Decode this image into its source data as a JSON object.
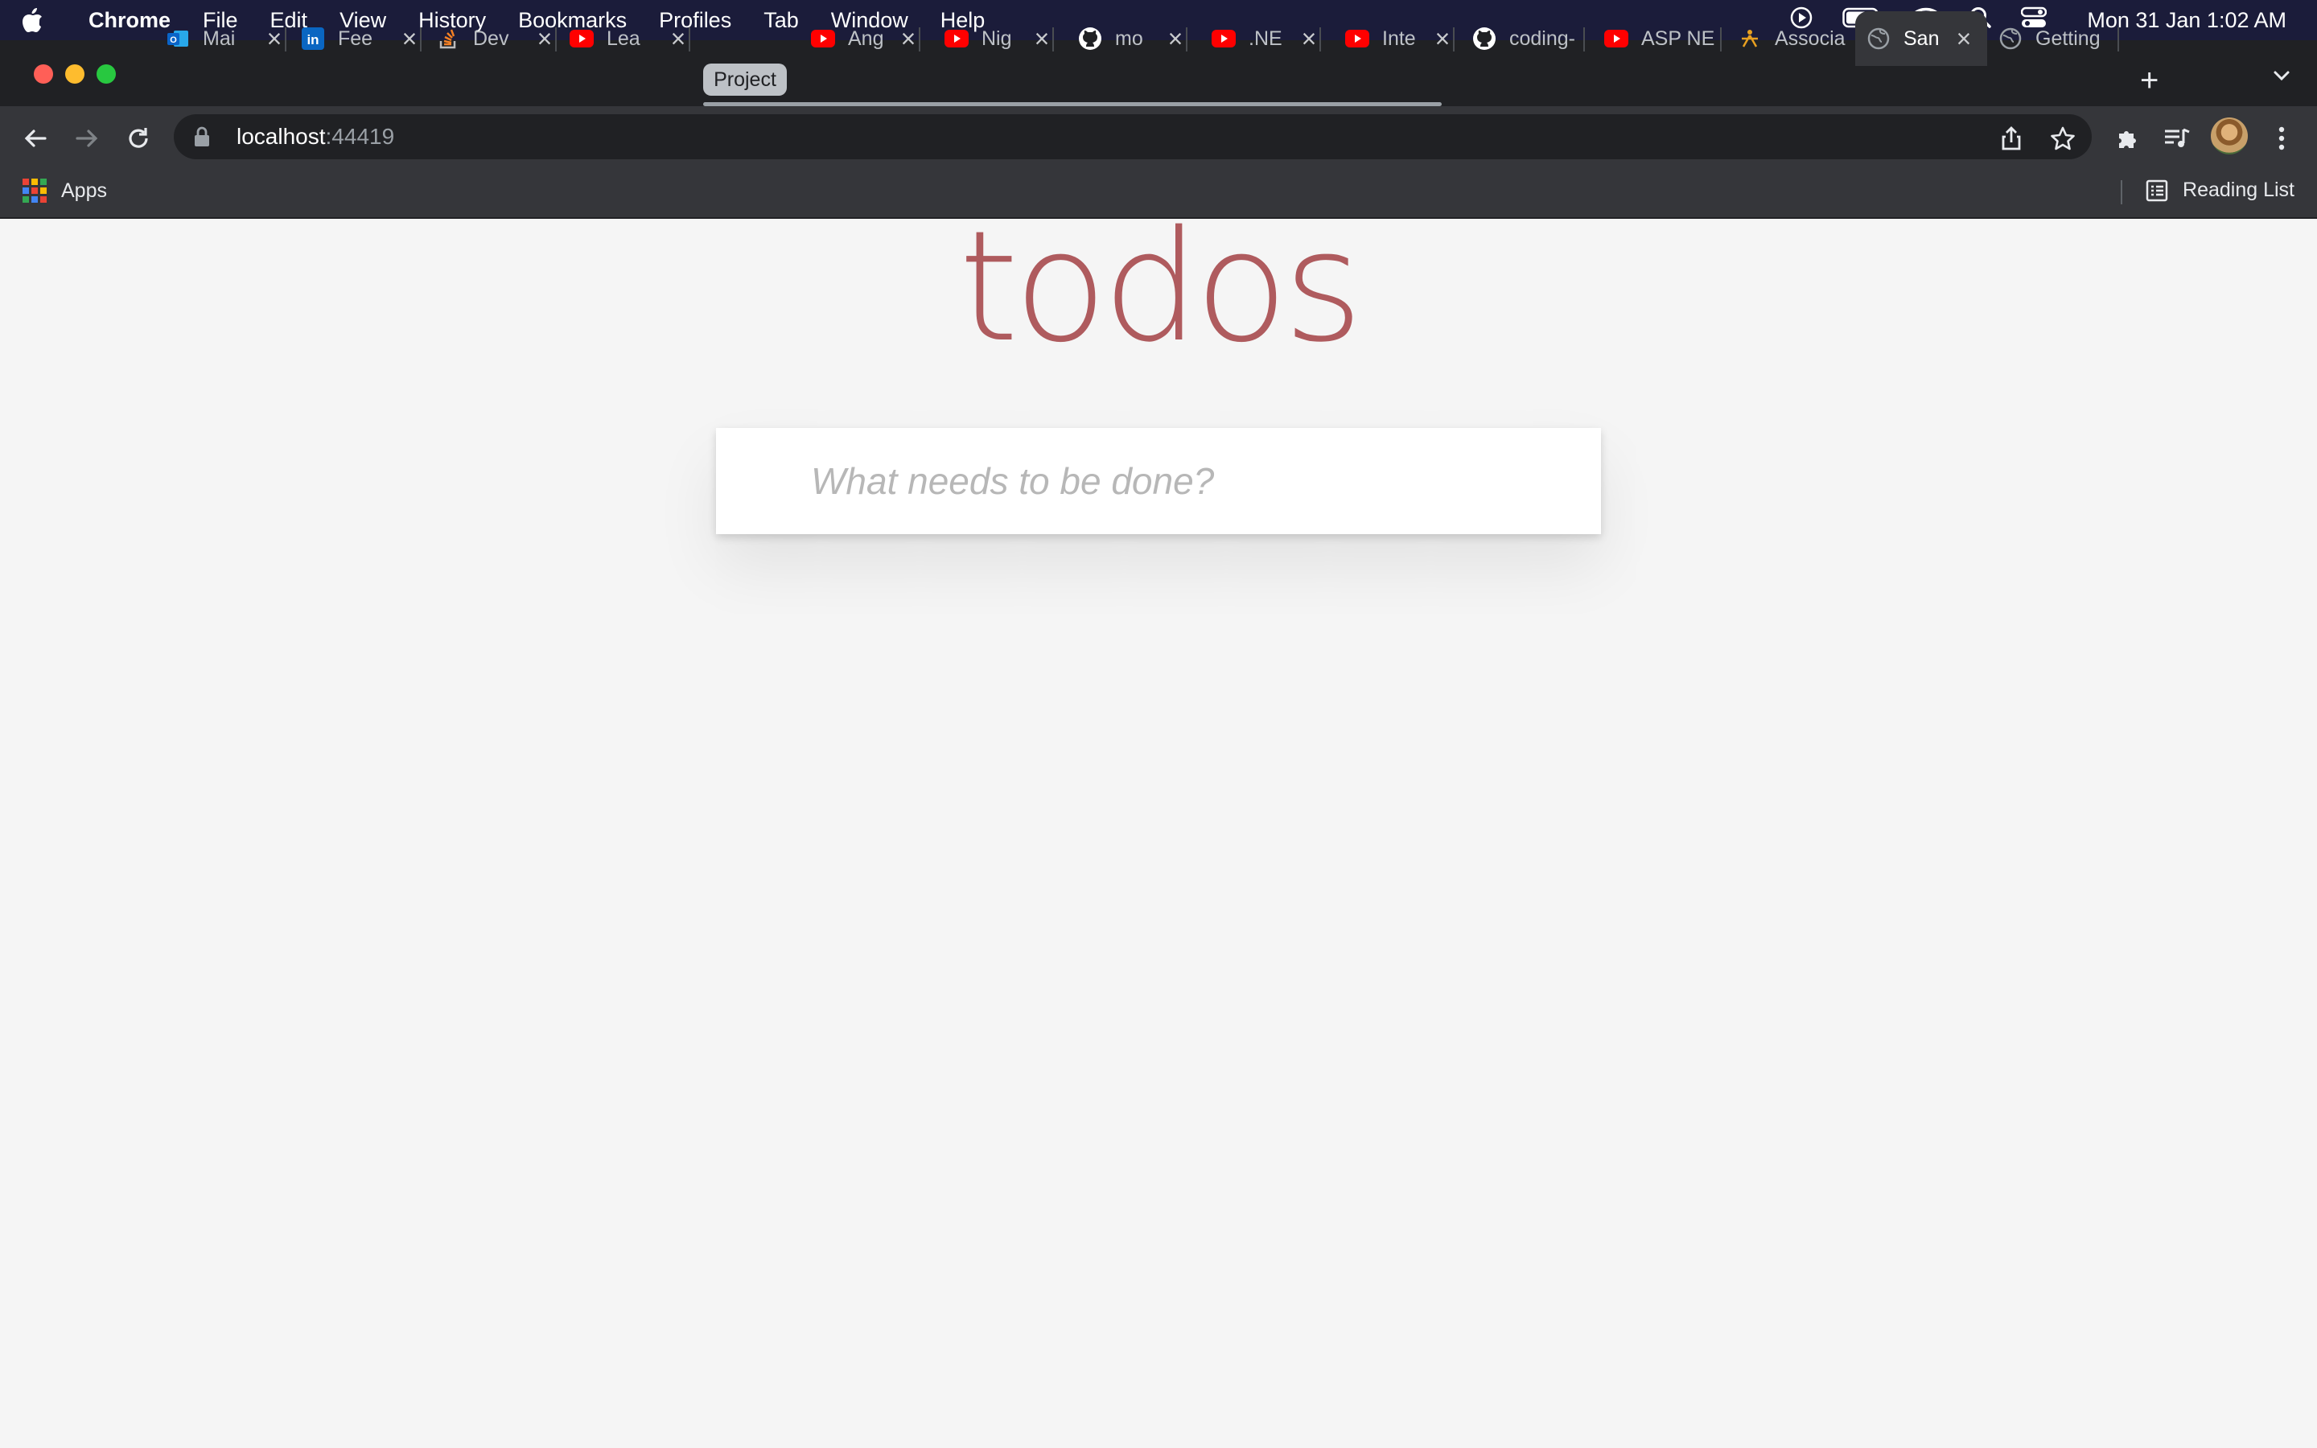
{
  "menubar": {
    "app_name": "Chrome",
    "items": [
      "File",
      "Edit",
      "View",
      "History",
      "Bookmarks",
      "Profiles",
      "Tab",
      "Window",
      "Help"
    ],
    "clock": "Mon 31 Jan  1:02 AM"
  },
  "tabs": [
    {
      "title": "Mai",
      "icon": "outlook-icon",
      "color": "#0a64c8"
    },
    {
      "title": "Fee",
      "icon": "linkedin-icon",
      "color": "#0a66c2"
    },
    {
      "title": "Dev",
      "icon": "stackoverflow-icon",
      "color": "#f48024"
    },
    {
      "title": "Lea",
      "icon": "youtube-icon",
      "color": "#ff0000"
    },
    {
      "title": "Ang",
      "icon": "youtube-icon",
      "color": "#ff0000"
    },
    {
      "title": "Nig",
      "icon": "youtube-icon",
      "color": "#ff0000"
    },
    {
      "title": "mo",
      "icon": "github-icon",
      "color": "#ffffff"
    },
    {
      "title": ".NE",
      "icon": "youtube-icon",
      "color": "#ff0000"
    },
    {
      "title": "Inte",
      "icon": "youtube-icon",
      "color": "#ff0000"
    },
    {
      "title": "coding-",
      "icon": "github-icon",
      "color": "#ffffff"
    },
    {
      "title": "ASP NE",
      "icon": "youtube-icon",
      "color": "#ff0000"
    },
    {
      "title": "Associa",
      "icon": "associa-icon",
      "color": "#e8a020"
    },
    {
      "title": "San",
      "icon": "globe-icon",
      "color": "#9aa0a6",
      "active": true
    },
    {
      "title": "Getting",
      "icon": "globe-icon",
      "color": "#9aa0a6"
    }
  ],
  "tab_group": {
    "label": "Project"
  },
  "omnibox": {
    "host": "localhost",
    "port": ":44419"
  },
  "bookmarks": {
    "apps_label": "Apps",
    "reading_list_label": "Reading List"
  },
  "app": {
    "title": "todos",
    "input_placeholder": "What needs to be done?",
    "title_color": "#af5b5e"
  }
}
